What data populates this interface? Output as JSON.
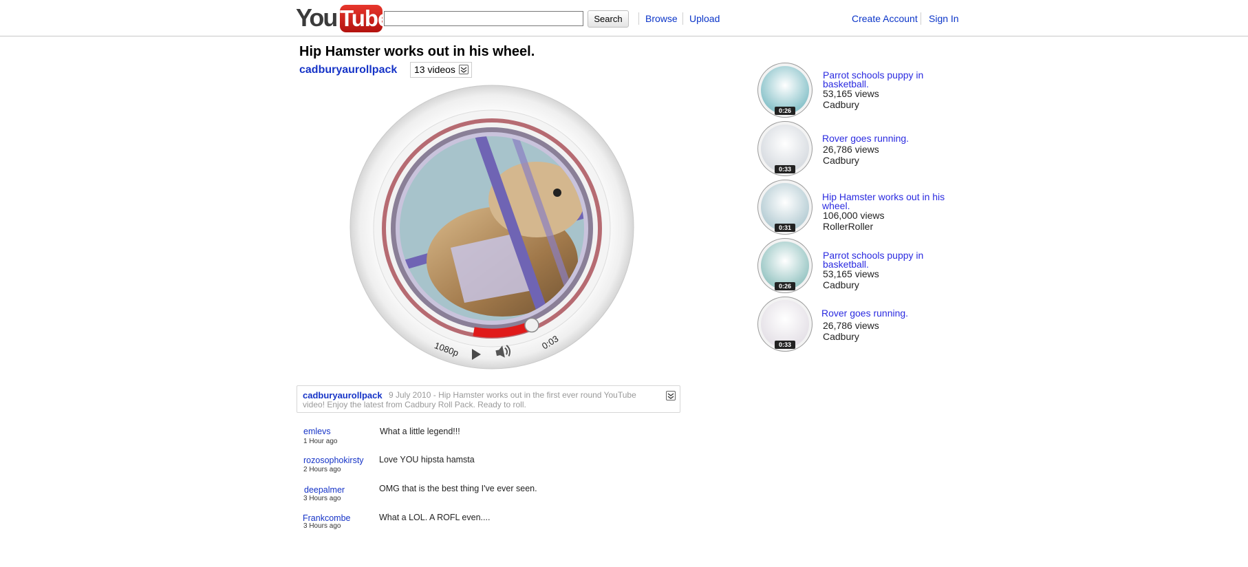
{
  "header": {
    "logo_you": "You",
    "logo_tube": "Tube",
    "search_placeholder": "",
    "search_button": "Search",
    "nav": {
      "browse": "Browse",
      "upload": "Upload"
    },
    "account": {
      "create": "Create Account",
      "sign_in": "Sign In"
    }
  },
  "video": {
    "title": "Hip Hamster works out in his wheel.",
    "channel": "cadburyaurollpack",
    "playlist_label": "13 videos",
    "progress_fraction": 0.1,
    "player": {
      "quality": "1080p",
      "time": "0:03"
    }
  },
  "description": {
    "user": "cadburyaurollpack",
    "date": "9 July 2010 -",
    "text": "Hip Hamster works out in the first ever round YouTube video! Enjoy the latest from Cadbury Roll Pack. Ready to roll."
  },
  "comments": [
    {
      "user": "emlevs",
      "time": "1 Hour ago",
      "text": "What a little legend!!!"
    },
    {
      "user": "rozosophokirsty",
      "time": "2 Hours ago",
      "text": "Love YOU hipsta hamsta"
    },
    {
      "user": "deepalmer",
      "time": "3 Hours ago",
      "text": "OMG that is the best thing I've ever seen."
    },
    {
      "user": "Frankcombe",
      "time": "3 Hours ago",
      "text": "What a LOL. A ROFL even...."
    }
  ],
  "related": [
    {
      "title": "Parrot schools puppy in basketball.",
      "views": "53,165 views",
      "author": "Cadbury",
      "duration": "0:26",
      "color": "#8ec5cc"
    },
    {
      "title": "Rover goes running.",
      "views": "26,786 views",
      "author": "Cadbury",
      "duration": "0:33",
      "color": "#d9dde2"
    },
    {
      "title": "Hip Hamster works out in his wheel.",
      "views": "106,000 views",
      "author": "RollerRoller",
      "duration": "0:31",
      "color": "#b9cfd6"
    },
    {
      "title": "Parrot schools puppy in basketball.",
      "views": "53,165 views",
      "author": "Cadbury",
      "duration": "0:26",
      "color": "#9cc8c6"
    },
    {
      "title": "Rover goes running.",
      "views": "26,786 views",
      "author": "Cadbury",
      "duration": "0:33",
      "color": "#e6e2e8"
    }
  ],
  "colors": {
    "link": "#1533c7",
    "progress": "#e01a1a",
    "youtube_red": "#d42b20"
  }
}
